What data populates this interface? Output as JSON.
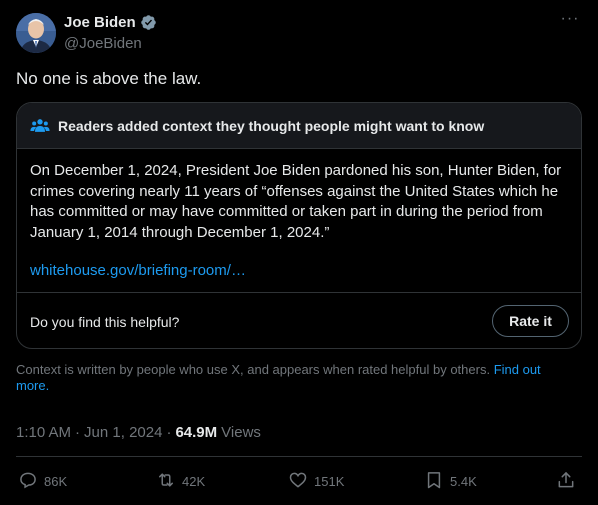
{
  "author": {
    "display_name": "Joe Biden",
    "handle": "@JoeBiden",
    "verified_icon": "verified-badge-icon",
    "more_icon": "more-icon",
    "more_glyph": "···"
  },
  "tweet": {
    "text": "No one is above the law."
  },
  "community_note": {
    "title": "Readers added context they thought people might want to know",
    "body": "On December 1, 2024, President Joe Biden pardoned his son, Hunter Biden, for crimes covering nearly 11 years of “offenses against the United States which he has committed or may have committed or taken part in during the period from January 1, 2014 through December 1, 2024.”",
    "link": "whitehouse.gov/briefing-room/…",
    "helpful_question": "Do you find this helpful?",
    "rate_label": "Rate it"
  },
  "disclaimer": {
    "text": "Context is written by people who use X, and appears when rated helpful by others.",
    "link": "Find out more."
  },
  "meta": {
    "time": "1:10 AM",
    "separator": "·",
    "date": "Jun 1, 2024",
    "views_count": "64.9M",
    "views_label": "Views"
  },
  "actions": {
    "replies": "86K",
    "reposts": "42K",
    "likes": "151K",
    "bookmarks": "5.4K"
  },
  "colors": {
    "background": "#000000",
    "text": "#e7e9ea",
    "muted": "#71767b",
    "accent": "#1d9bf0",
    "border": "#2f3336"
  }
}
